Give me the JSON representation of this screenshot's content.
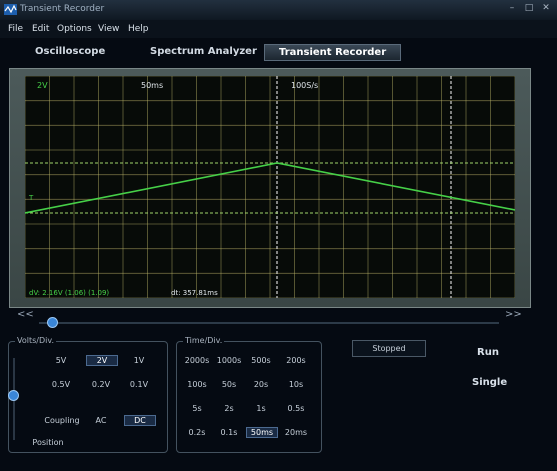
{
  "window": {
    "title": "Transient Recorder",
    "minimize_glyph": "–",
    "maximize_glyph": "□",
    "close_glyph": "✕"
  },
  "menu": [
    "File",
    "Edit",
    "Options",
    "View",
    "Help"
  ],
  "tabs": [
    {
      "label": "Oscilloscope",
      "active": false
    },
    {
      "label": "Spectrum Analyzer",
      "active": false
    },
    {
      "label": "Transient Recorder",
      "active": true
    }
  ],
  "scope": {
    "volts_label": "2V",
    "time_label": "50ms",
    "rate_label": "100S/s",
    "trigger_marker": "T",
    "readout_dv": "dV: 2.16V  (1.06) (1.09)",
    "readout_dt": "dt: 357.81ms",
    "colors": {
      "trace": "#46d048",
      "grid": "#bdb66a",
      "cursor": "#9fd66a",
      "screen": "#070b08"
    }
  },
  "scroll": {
    "left_glyph": "<<",
    "right_glyph": ">>"
  },
  "volts_div": {
    "title": "Volts/Div.",
    "options": [
      "5V",
      "2V",
      "1V",
      "0.5V",
      "0.2V",
      "0.1V"
    ],
    "selected": "2V",
    "coupling_label": "Coupling",
    "coupling_options": [
      "AC",
      "DC"
    ],
    "coupling_selected": "DC",
    "position_label": "Position"
  },
  "time_div": {
    "title": "Time/Div.",
    "options": [
      "2000s",
      "1000s",
      "500s",
      "200s",
      "100s",
      "50s",
      "20s",
      "10s",
      "5s",
      "2s",
      "1s",
      "0.5s",
      "0.2s",
      "0.1s",
      "50ms",
      "20ms"
    ],
    "selected": "50ms"
  },
  "status": "Stopped",
  "actions": {
    "run": "Run",
    "single": "Single"
  }
}
